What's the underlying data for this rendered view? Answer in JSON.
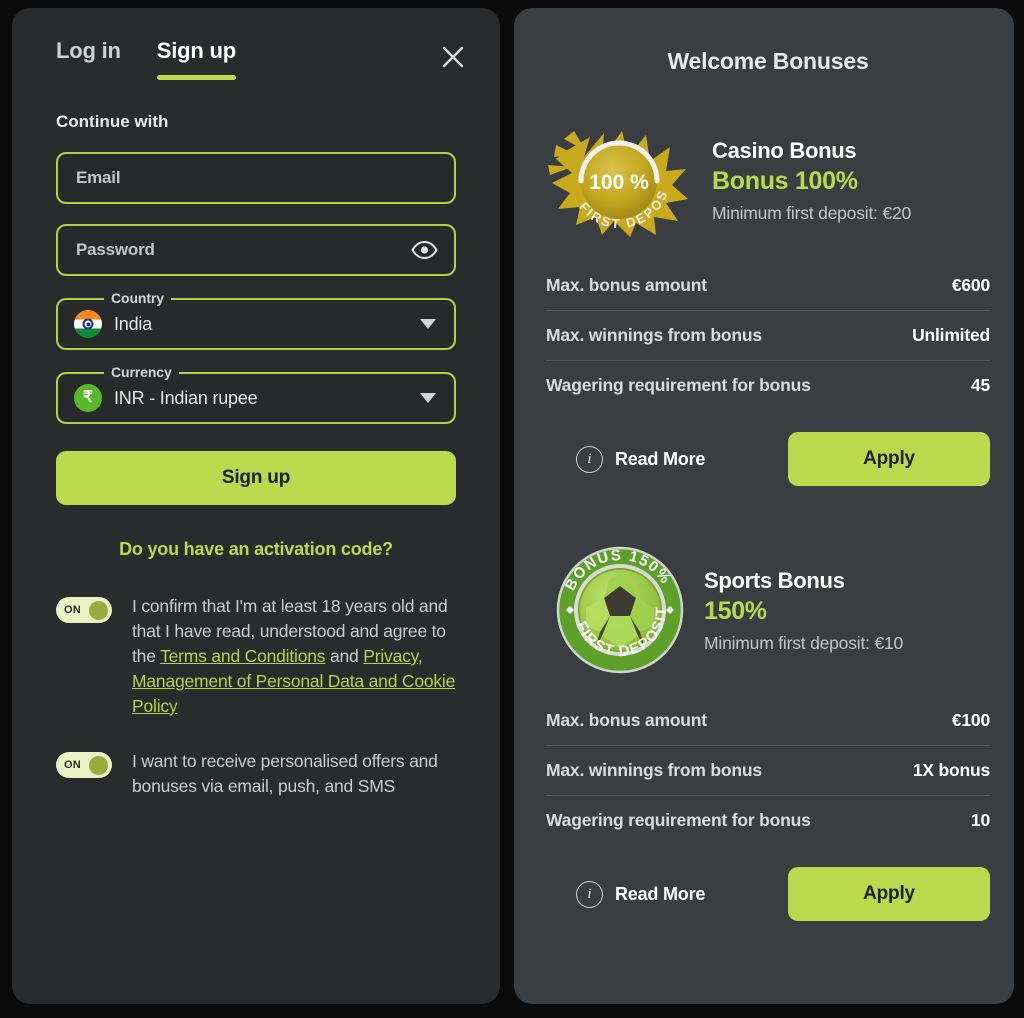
{
  "auth": {
    "tabs": [
      {
        "label": "Log in",
        "active": false
      },
      {
        "label": "Sign up",
        "active": true
      }
    ],
    "close_icon": "close-icon",
    "continue_with": "Continue with",
    "email": {
      "placeholder": "Email",
      "value": ""
    },
    "password": {
      "placeholder": "Password",
      "value": "",
      "reveal_icon": "eye-icon"
    },
    "country": {
      "legend": "Country",
      "value": "India",
      "flag": "india-flag-icon"
    },
    "currency": {
      "legend": "Currency",
      "value": "INR - Indian rupee",
      "symbol": "₹"
    },
    "signup_button": "Sign up",
    "activation_link": "Do you have an activation code?",
    "consents": [
      {
        "toggle_label": "ON",
        "state": "on",
        "text_parts": [
          {
            "type": "text",
            "value": "I confirm that I'm at least 18 years old and that I have read, understood and agree to the "
          },
          {
            "type": "link",
            "value": "Terms and Conditions"
          },
          {
            "type": "text",
            "value": " and "
          },
          {
            "type": "link",
            "value": "Privacy, Management of Personal Data and Cookie Policy"
          }
        ]
      },
      {
        "toggle_label": "ON",
        "state": "on",
        "text_parts": [
          {
            "type": "text",
            "value": "I want to receive personalised offers and bonuses via email, push, and SMS"
          }
        ]
      }
    ]
  },
  "bonuses": {
    "title": "Welcome Bonuses",
    "cards": [
      {
        "badge": {
          "icon": "gold-first-deposit-badge-icon",
          "percent_text": "100 %",
          "arc_text": "FIRST DEPOSIT"
        },
        "name": "Casino Bonus",
        "amount": "Bonus 100%",
        "minimum": "Minimum first deposit: €20",
        "specs": [
          {
            "label": "Max. bonus amount",
            "value": "€600"
          },
          {
            "label": "Max. winnings from bonus",
            "value": "Unlimited"
          },
          {
            "label": "Wagering requirement for bonus",
            "value": "45"
          }
        ],
        "read_more": "Read More",
        "apply": "Apply"
      },
      {
        "badge": {
          "icon": "green-football-bonus-badge-icon",
          "top_text": "BONUS 150%",
          "arc_text": "FIRST DEPOSIT"
        },
        "name": "Sports Bonus",
        "amount": "150%",
        "minimum": "Minimum first deposit: €10",
        "specs": [
          {
            "label": "Max. bonus amount",
            "value": "€100"
          },
          {
            "label": "Max. winnings from bonus",
            "value": "1X bonus"
          },
          {
            "label": "Wagering requirement for bonus",
            "value": "10"
          }
        ],
        "read_more": "Read More",
        "apply": "Apply"
      }
    ]
  },
  "colors": {
    "accent": "#bcd94e",
    "page_bg": "#0b0b0c",
    "auth_panel_bg": "#2a2b2c",
    "bonus_panel_bg": "#3b3e40",
    "gold": "#c9a91f",
    "sport_green": "#5da02a"
  }
}
